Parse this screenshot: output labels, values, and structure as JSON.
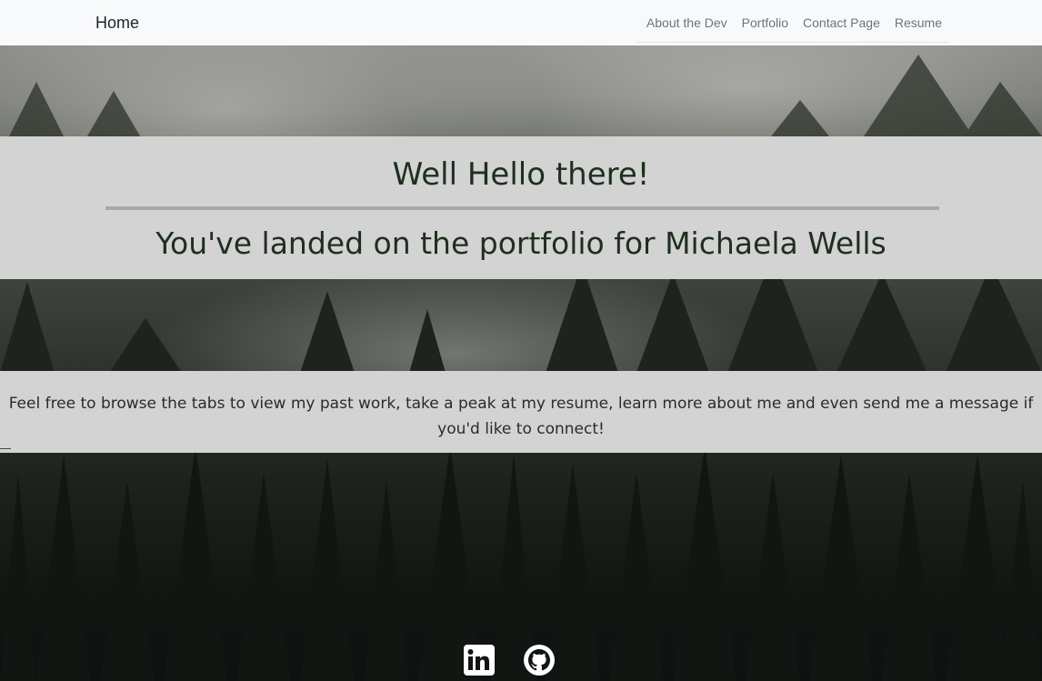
{
  "navbar": {
    "brand": "Home",
    "links": [
      "About the Dev",
      "Portfolio",
      "Contact Page",
      "Resume"
    ]
  },
  "hero": {
    "greeting": "Well Hello there!",
    "subtitle": "You've landed on the portfolio for Michaela Wells",
    "intro": "Feel free to browse the tabs to view my past work, take a peak at my resume, learn more about me and even send me a message if you'd like to connect!"
  },
  "social": {
    "icons": [
      "linkedin-icon",
      "github-icon"
    ]
  },
  "colors": {
    "navbar_bg": "#f8f9fa",
    "banner_bg": "#d3d3d3",
    "heading_text": "#1f2f1e"
  }
}
